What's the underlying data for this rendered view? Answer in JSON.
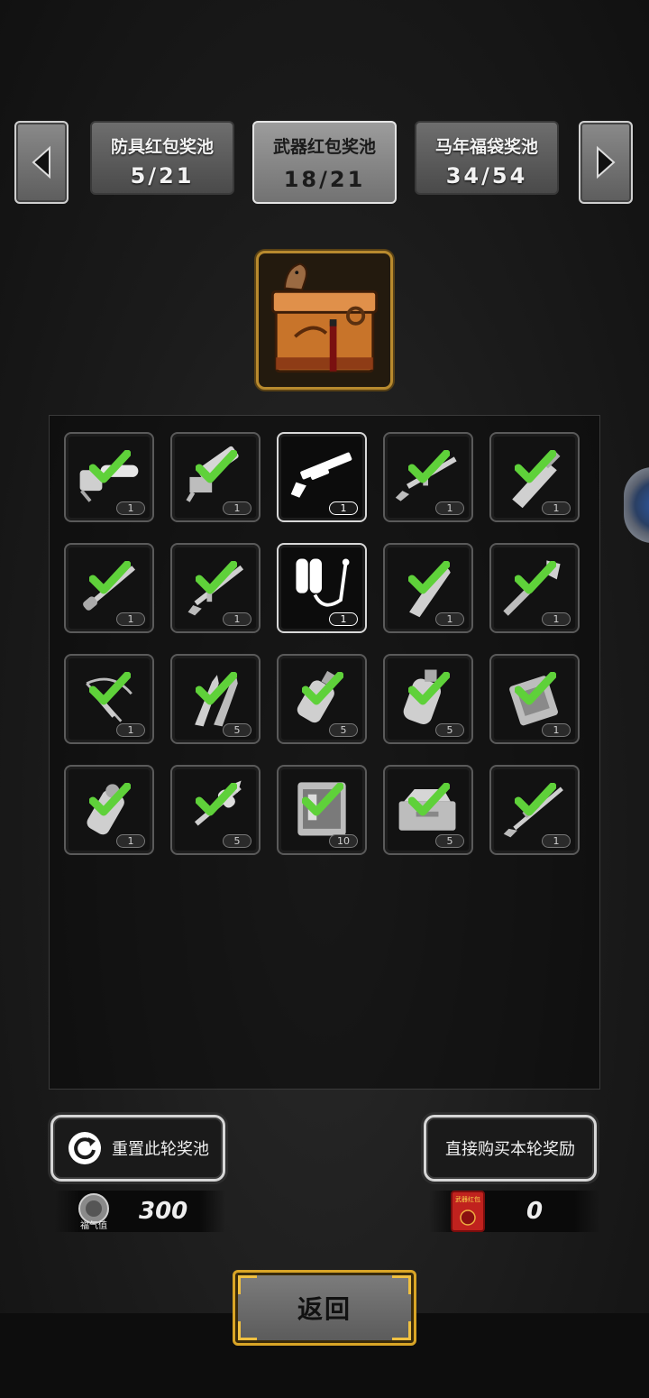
{
  "tabs": [
    {
      "name": "防具红包奖池",
      "count": "5/21",
      "active": false
    },
    {
      "name": "武器红包奖池",
      "count": "18/21",
      "active": true
    },
    {
      "name": "马年福袋奖池",
      "count": "34/54",
      "active": false
    }
  ],
  "items": [
    {
      "icon": "chainsaw-icon",
      "qty": "1",
      "claimed": true
    },
    {
      "icon": "minigun-icon",
      "qty": "1",
      "claimed": true
    },
    {
      "icon": "shotgun-icon",
      "qty": "1",
      "claimed": false
    },
    {
      "icon": "rifle-icon",
      "qty": "1",
      "claimed": true
    },
    {
      "icon": "blade-icon",
      "qty": "1",
      "claimed": true
    },
    {
      "icon": "bayonet-icon",
      "qty": "1",
      "claimed": true
    },
    {
      "icon": "assault-rifle-icon",
      "qty": "1",
      "claimed": true
    },
    {
      "icon": "flamethrower-icon",
      "qty": "1",
      "claimed": false
    },
    {
      "icon": "machete-icon",
      "qty": "1",
      "claimed": true
    },
    {
      "icon": "shovel-icon",
      "qty": "1",
      "claimed": true
    },
    {
      "icon": "crossbow-icon",
      "qty": "1",
      "claimed": true
    },
    {
      "icon": "bullets-icon",
      "qty": "5",
      "claimed": true
    },
    {
      "icon": "grenade-icon",
      "qty": "5",
      "claimed": true
    },
    {
      "icon": "frag-grenade-icon",
      "qty": "5",
      "claimed": true
    },
    {
      "icon": "armor-plate-icon",
      "qty": "1",
      "claimed": true
    },
    {
      "icon": "flashbang-icon",
      "qty": "1",
      "claimed": true
    },
    {
      "icon": "rocket-icon",
      "qty": "5",
      "claimed": true
    },
    {
      "icon": "toolkit-icon",
      "qty": "10",
      "claimed": true
    },
    {
      "icon": "toolbox-icon",
      "qty": "5",
      "claimed": true
    },
    {
      "icon": "sniper-rifle-icon",
      "qty": "1",
      "claimed": true
    }
  ],
  "actions": {
    "reset_label": "重置此轮奖池",
    "buy_label": "直接购买本轮奖励"
  },
  "currencies": {
    "luck_icon_text": "福气值",
    "luck_value": "300",
    "redpacket_icon_text": "武器红包",
    "redpacket_value": "0"
  },
  "back_label": "返回",
  "colors": {
    "check": "#5fd13a",
    "gold_frame": "#d9a526"
  }
}
